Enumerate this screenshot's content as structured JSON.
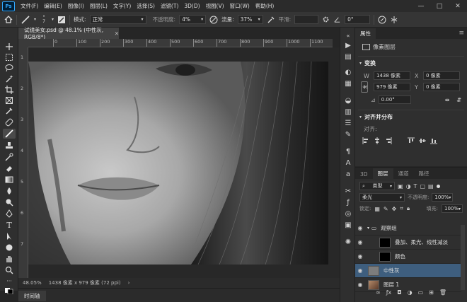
{
  "app": {
    "logo": "Ps"
  },
  "menu": [
    "文件(F)",
    "编辑(E)",
    "图像(I)",
    "图层(L)",
    "文字(Y)",
    "选择(S)",
    "滤镜(T)",
    "3D(D)",
    "视图(V)",
    "窗口(W)",
    "帮助(H)"
  ],
  "window_controls": {
    "minimize": "—",
    "restore": "□",
    "close": "✕"
  },
  "options": {
    "brush_size": "7",
    "mode_label": "模式:",
    "mode_value": "正常",
    "opacity_label": "不透明度:",
    "opacity_value": "4%",
    "flow_label": "流量:",
    "flow_value": "37%",
    "smooth_label": "平滑:",
    "smooth_value": "",
    "angle_value": "0°"
  },
  "document": {
    "tab_title": "试镜美女.psd @ 48.1% (中性灰, RGB/8*)",
    "zoom": "48.05%",
    "dimensions": "1438 像素 x 979 像素 (72 ppi)"
  },
  "ruler": {
    "top_ticks": [
      "0",
      "100",
      "200",
      "300",
      "400",
      "500",
      "600",
      "700",
      "800",
      "900",
      "1000",
      "1100"
    ],
    "left_ticks": [
      "1",
      "2",
      "3",
      "4",
      "5",
      "6",
      "7"
    ]
  },
  "bottom": {
    "timeline": "时间轴"
  },
  "properties": {
    "tab": "属性",
    "layer_kind": "像素图层",
    "transform_title": "变换",
    "w_label": "W",
    "w_value": "1438 像素",
    "x_label": "X",
    "x_value": "0 像素",
    "h_label": "H",
    "h_value": "979 像素",
    "y_label": "Y",
    "y_value": "0 像素",
    "angle": "0.00°",
    "align_title": "对齐并分布",
    "align_label": "对齐:"
  },
  "layers_panel": {
    "tabs": [
      "3D",
      "图层",
      "通道",
      "路径"
    ],
    "filter_kind": "类型",
    "blend_mode": "柔光",
    "opacity_label": "不透明度:",
    "opacity_value": "100%",
    "lock_label": "锁定:",
    "fill_label": "填充:",
    "fill_value": "100%",
    "layers": [
      {
        "name": "观察组",
        "type": "group"
      },
      {
        "name": "叠加、柔光、线性减淡",
        "type": "black"
      },
      {
        "name": "颜色",
        "type": "black"
      },
      {
        "name": "中性灰",
        "type": "gray",
        "selected": true
      },
      {
        "name": "图层 1",
        "type": "photo"
      }
    ]
  },
  "colors": {
    "accent": "#31a8ff",
    "selected_layer": "#3e5e7e"
  }
}
